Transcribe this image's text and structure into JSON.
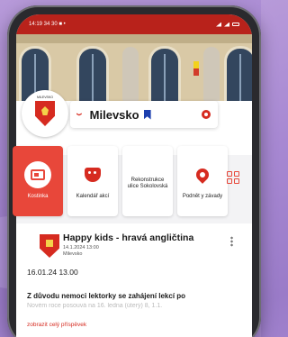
{
  "colors": {
    "brand": "#d62b20",
    "accent_tile": "#e8473a",
    "statusbar": "#b8221b",
    "bookmark": "#1c3fae"
  },
  "statusbar": {
    "time_text": "14:19 34 30 ■ •",
    "right_text": "ᯤ ◢ ◢ 5%"
  },
  "header": {
    "town_name": "Milevsko",
    "crest_caption": "MILEVSKO",
    "icons": {
      "dropdown": "chevron-down-icon",
      "bookmark": "bookmark-icon",
      "settings": "gear-icon"
    }
  },
  "tiles": [
    {
      "label": "Kostinka",
      "icon": "newspaper-icon",
      "active": true
    },
    {
      "label": "Kalendář akcí",
      "icon": "theater-masks-icon",
      "active": false
    },
    {
      "label": "Rekonstrukce ulice Sokolovská",
      "icon": "",
      "active": false
    },
    {
      "label": "Podnět y závady",
      "icon": "map-pin-icon",
      "active": false
    }
  ],
  "post": {
    "title": "Happy kids - hravá angličtina",
    "sub_date": "14.1.2024 13:00",
    "sub_source": "Milevsko",
    "date_line": "16.01.24 13.00",
    "text_line1": "Z důvodu nemoci lektorky se zahájení lekcí po",
    "text_line2": "Novém roce posouvá na 16. ledna (úterý) 8, 1.1.",
    "more_link": "zobrazit celý příspěvek"
  }
}
